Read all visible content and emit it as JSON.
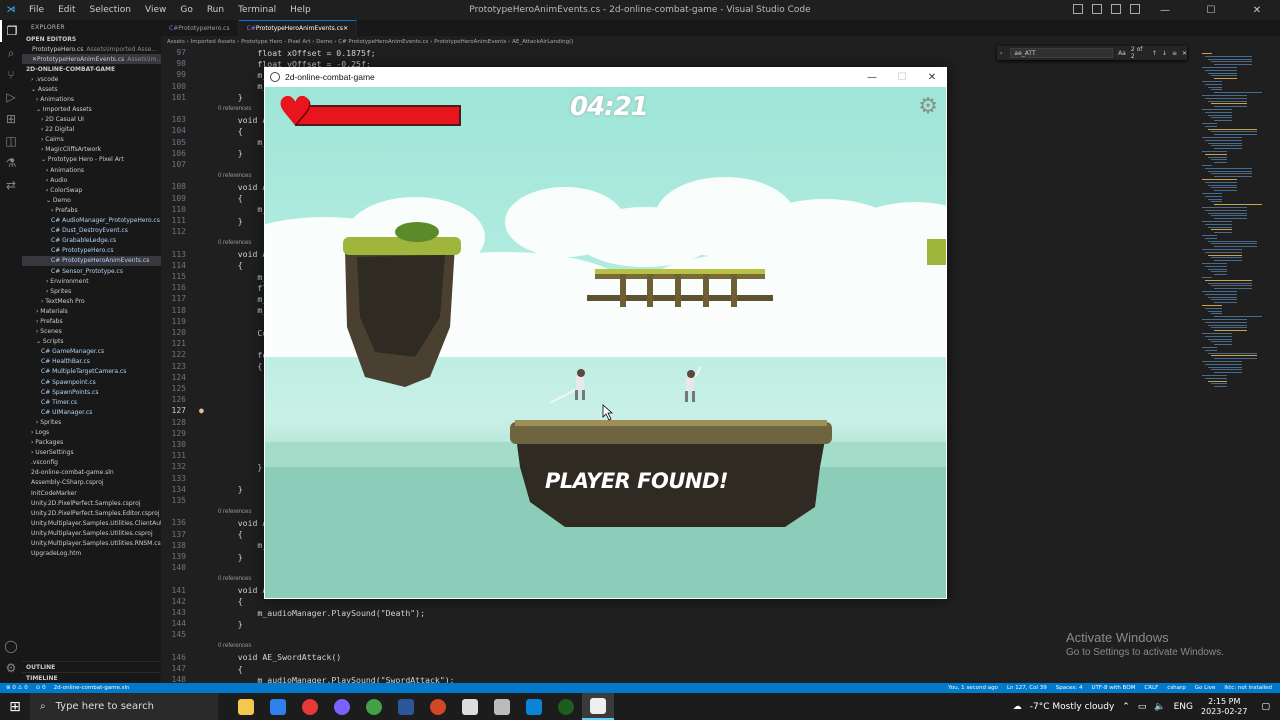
{
  "window": {
    "title": "PrototypeHeroAnimEvents.cs - 2d-online-combat-game - Visual Studio Code",
    "menu": [
      "File",
      "Edit",
      "Selection",
      "View",
      "Go",
      "Run",
      "Terminal",
      "Help"
    ]
  },
  "explorer": {
    "header": "EXPLORER",
    "open_editors_label": "OPEN EDITORS",
    "open_editors": [
      {
        "name": "PrototypeHero.cs",
        "path": "Assets\\Imported Asse..."
      },
      {
        "name": "PrototypeHeroAnimEvents.cs",
        "path": "Assets\\Im..."
      }
    ],
    "project_label": "2D-ONLINE-COMBAT-GAME",
    "tree": [
      {
        "label": "› .vscode",
        "indent": 1
      },
      {
        "label": "⌄ Assets",
        "indent": 1
      },
      {
        "label": "› Animations",
        "indent": 2
      },
      {
        "label": "⌄ Imported Assets",
        "indent": 2
      },
      {
        "label": "› 2D Casual UI",
        "indent": 3
      },
      {
        "label": "› 22 Digital",
        "indent": 3
      },
      {
        "label": "› Caims",
        "indent": 3
      },
      {
        "label": "› MagicCliffsArtwork",
        "indent": 3
      },
      {
        "label": "⌄ Prototype Hero - Pixel Art",
        "indent": 3
      },
      {
        "label": "› Animations",
        "indent": 4
      },
      {
        "label": "› Audio",
        "indent": 4
      },
      {
        "label": "› ColorSwap",
        "indent": 4
      },
      {
        "label": "⌄ Demo",
        "indent": 4
      },
      {
        "label": "› Prefabs",
        "indent": 5
      },
      {
        "label": "C# AudioManager_PrototypeHero.cs",
        "indent": 5
      },
      {
        "label": "C# Dust_DestroyEvent.cs",
        "indent": 5
      },
      {
        "label": "C# GrabableLedge.cs",
        "indent": 5
      },
      {
        "label": "C# PrototypeHero.cs",
        "indent": 5
      },
      {
        "label": "C# PrototypeHeroAnimEvents.cs",
        "indent": 5,
        "selected": true
      },
      {
        "label": "C# Sensor_Prototype.cs",
        "indent": 5
      },
      {
        "label": "› Environment",
        "indent": 4
      },
      {
        "label": "› Sprites",
        "indent": 4
      },
      {
        "label": "› TextMesh Pro",
        "indent": 3
      },
      {
        "label": "› Materials",
        "indent": 2
      },
      {
        "label": "› Prefabs",
        "indent": 2
      },
      {
        "label": "› Scenes",
        "indent": 2
      },
      {
        "label": "⌄ Scripts",
        "indent": 2
      },
      {
        "label": "C# GameManager.cs",
        "indent": 3
      },
      {
        "label": "C# HealthBar.cs",
        "indent": 3
      },
      {
        "label": "C# MultipleTargetCamera.cs",
        "indent": 3
      },
      {
        "label": "C# Spawnpoint.cs",
        "indent": 3
      },
      {
        "label": "C# SpawnPoints.cs",
        "indent": 3
      },
      {
        "label": "C# Timer.cs",
        "indent": 3
      },
      {
        "label": "C# UIManager.cs",
        "indent": 3
      },
      {
        "label": "› Sprites",
        "indent": 2
      },
      {
        "label": "› Logs",
        "indent": 1
      },
      {
        "label": "› Packages",
        "indent": 1
      },
      {
        "label": "› UserSettings",
        "indent": 1
      },
      {
        "label": ".vsconfig",
        "indent": 1
      },
      {
        "label": "2d-online-combat-game.sln",
        "indent": 1
      },
      {
        "label": "Assembly-CSharp.csproj",
        "indent": 1
      },
      {
        "label": "InitCodeMarker",
        "indent": 1
      },
      {
        "label": "Unity.2D.PixelPerfect.Samples.csproj",
        "indent": 1
      },
      {
        "label": "Unity.2D.PixelPerfect.Samples.Editor.csproj",
        "indent": 1
      },
      {
        "label": "Unity.Multiplayer.Samples.Utilities.ClientAut...",
        "indent": 1
      },
      {
        "label": "Unity.Multiplayer.Samples.Utilities.csproj",
        "indent": 1
      },
      {
        "label": "Unity.Multiplayer.Samples.Utilities.RNSM.csp...",
        "indent": 1
      },
      {
        "label": "UpgradeLog.htm",
        "indent": 1
      }
    ],
    "outline_label": "OUTLINE",
    "timeline_label": "TIMELINE"
  },
  "tabs": [
    {
      "label": "PrototypeHero.cs",
      "active": false
    },
    {
      "label": "PrototypeHeroAnimEvents.cs",
      "active": true
    }
  ],
  "breadcrumb": "Assets › Imported Assets › Prototype Hero - Pixel Art › Demo › C# PrototypeHeroAnimEvents.cs › PrototypeHeroAnimEvents › AE_AttackAirLanding()",
  "find": {
    "value": "ae_ATT",
    "count": "2 of 2"
  },
  "code_lines": [
    {
      "n": "97",
      "t": "        float xOffset = 0.1875f;"
    },
    {
      "n": "98",
      "t": "        float yOffset = -0.25f;"
    },
    {
      "n": "99",
      "t": "        m_pla"
    },
    {
      "n": "100",
      "t": "        m_pla"
    },
    {
      "n": "101",
      "t": "    }"
    },
    {
      "ref": "0 references"
    },
    {
      "n": "103",
      "t": "    void AE_P"
    },
    {
      "n": "104",
      "t": "    {"
    },
    {
      "n": "105",
      "t": "        m_aud"
    },
    {
      "n": "106",
      "t": "    }"
    },
    {
      "n": "107",
      "t": ""
    },
    {
      "ref": "0 references"
    },
    {
      "n": "108",
      "t": "    void AE_A"
    },
    {
      "n": "109",
      "t": "    {"
    },
    {
      "n": "110",
      "t": "        m_aud"
    },
    {
      "n": "111",
      "t": "    }"
    },
    {
      "n": "112",
      "t": ""
    },
    {
      "ref": "0 references"
    },
    {
      "n": "113",
      "t": "    void AE_A"
    },
    {
      "n": "114",
      "t": "    {"
    },
    {
      "n": "115",
      "t": "        m_aud"
    },
    {
      "n": "116",
      "t": "        float"
    },
    {
      "n": "117",
      "t": "        m_pla"
    },
    {
      "n": "118",
      "t": "        m_pla"
    },
    {
      "n": "119",
      "t": ""
    },
    {
      "n": "120",
      "t": "        Colli"
    },
    {
      "n": "121",
      "t": ""
    },
    {
      "n": "122",
      "t": "        forea"
    },
    {
      "n": "123",
      "t": "        {"
    },
    {
      "n": "124",
      "t": "            P"
    },
    {
      "n": "125",
      "t": "            P"
    },
    {
      "n": "126",
      "t": ""
    },
    {
      "n": "127",
      "t": "            i"
    },
    {
      "n": "128",
      "t": "            {"
    },
    {
      "n": "129",
      "t": ""
    },
    {
      "n": "130",
      "t": ""
    },
    {
      "n": "131",
      "t": "            }"
    },
    {
      "n": "132",
      "t": "        }"
    },
    {
      "n": "133",
      "t": ""
    },
    {
      "n": "134",
      "t": "    }"
    },
    {
      "n": "135",
      "t": ""
    },
    {
      "ref": "0 references"
    },
    {
      "n": "136",
      "t": "    void AE_H"
    },
    {
      "n": "137",
      "t": "    {"
    },
    {
      "n": "138",
      "t": "        m_aud"
    },
    {
      "n": "139",
      "t": "    }"
    },
    {
      "n": "140",
      "t": ""
    },
    {
      "ref": "0 references"
    },
    {
      "n": "141",
      "t": "    void AE_D"
    },
    {
      "n": "142",
      "t": "    {"
    },
    {
      "n": "143",
      "t": "        m_audioManager.PlaySound(\"Death\");"
    },
    {
      "n": "144",
      "t": "    }"
    },
    {
      "n": "145",
      "t": ""
    },
    {
      "ref": "0 references"
    },
    {
      "n": "146",
      "t": "    void AE_SwordAttack()"
    },
    {
      "n": "147",
      "t": "    {"
    },
    {
      "n": "148",
      "t": "        m_audioManager.PlaySound(\"SwordAttack\");"
    }
  ],
  "game": {
    "window_title": "2d-online-combat-game",
    "timer": "04:21",
    "health": 1.0,
    "banner": "PLAYER FOUND!"
  },
  "statusbar": {
    "left": [
      "⊗ 0 ⚠ 0",
      "⊙ 0",
      "2d-online-combat-game.sln"
    ],
    "right": [
      "You, 1 second ago",
      "Ln 127, Col 39",
      "Spaces: 4",
      "UTF-8 with BOM",
      "CRLF",
      "csharp",
      "Go Live",
      "lktc: not installed"
    ]
  },
  "activation": {
    "title": "Activate Windows",
    "subtitle": "Go to Settings to activate Windows."
  },
  "taskbar": {
    "search_placeholder": "Type here to search",
    "weather": "-7°C  Mostly cloudy",
    "lang": "ENG",
    "time": "2:15 PM",
    "date": "2023-02-27"
  },
  "colors": {
    "accent": "#007acc",
    "health": "#e8141e"
  }
}
